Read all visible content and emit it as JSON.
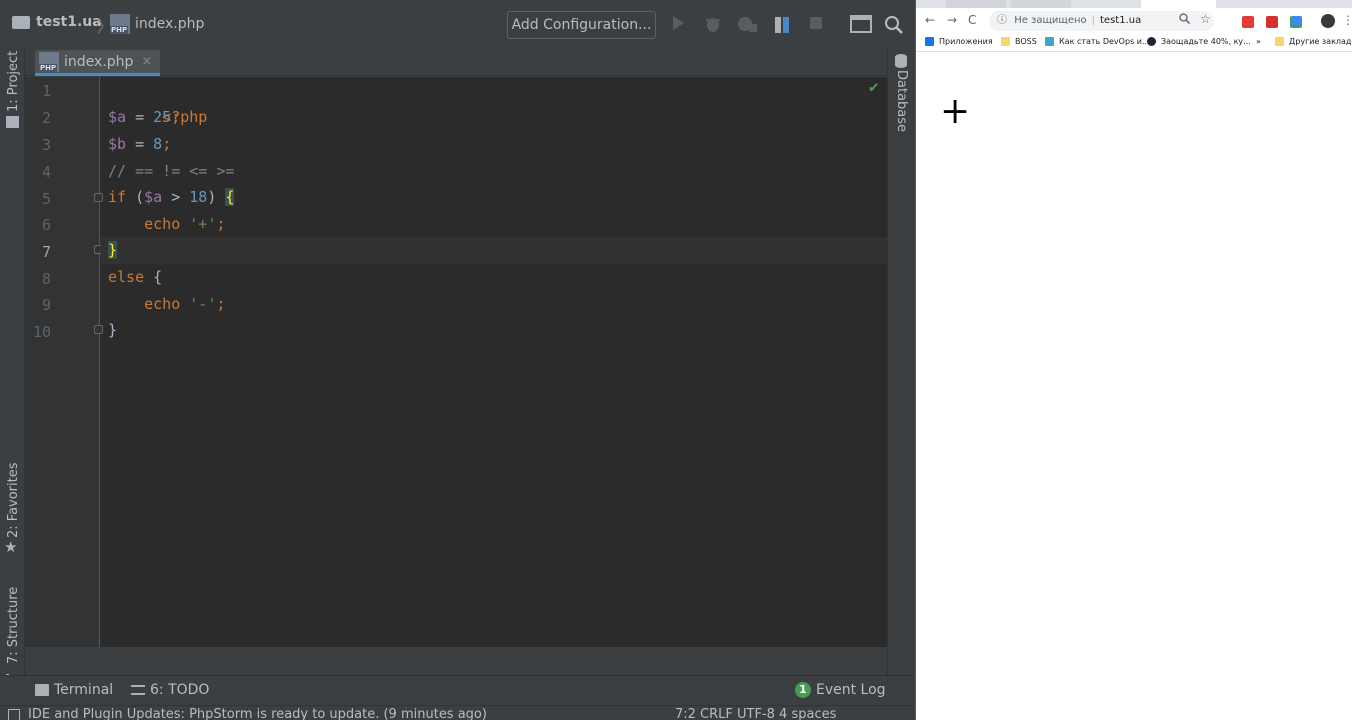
{
  "ide": {
    "breadcrumb": {
      "project": "test1.ua",
      "separator": "〉",
      "file": "index.php"
    },
    "toolbar": {
      "add_config_label": "Add Configuration...",
      "run_icon": "run-icon",
      "debug_icon": "debug-icon",
      "coverage_icon": "coverage-icon",
      "profile_icon": "profile-icon",
      "stop_icon": "stop-icon",
      "layout_icon": "layout-icon",
      "search_icon": "search-icon"
    },
    "left_strip": {
      "project": "1: Project",
      "favorites": "2: Favorites",
      "structure": "7: Structure"
    },
    "right_strip": {
      "database": "Database"
    },
    "tab": {
      "label": "index.php",
      "close": "×"
    },
    "editor": {
      "line_numbers": [
        "1",
        "2",
        "3",
        "4",
        "5",
        "6",
        "7",
        "8",
        "9",
        "10"
      ],
      "active_line": 7,
      "lines": [
        {
          "open_tag": "<?php"
        },
        {
          "var": "$a",
          "op": " = ",
          "num": "25",
          "end": ";"
        },
        {
          "var": "$b",
          "op": " = ",
          "num": "8",
          "end": ";"
        },
        {
          "comment": "// == != <= >="
        },
        {
          "kw": "if",
          "p1": " (",
          "var": "$a",
          "mid": " > ",
          "num": "18",
          "p2": ") ",
          "brace": "{"
        },
        {
          "indent": "    ",
          "kw": "echo",
          "sp": " ",
          "str": "'+'",
          "end": ";"
        },
        {
          "brace": "}"
        },
        {
          "kw": "else",
          "rest": " {"
        },
        {
          "indent": "    ",
          "kw": "echo",
          "sp": " ",
          "str": "'-'",
          "end": ";"
        },
        {
          "brace": "}"
        }
      ],
      "check_mark": "✔"
    },
    "bottom_tabs": {
      "terminal": "Terminal",
      "todo": "6: TODO",
      "event_log": "Event Log",
      "event_count": "1"
    },
    "status": {
      "message": "IDE and Plugin Updates: PhpStorm is ready to update. (9 minutes ago)",
      "right": "7:2  CRLF  UTF-8  4 spaces"
    }
  },
  "browser": {
    "nav": {
      "back": "←",
      "forward": "→",
      "reload": "C"
    },
    "omnibox": {
      "info": "ⓘ",
      "security": "Не защищено",
      "separator": "|",
      "url": "test1.ua"
    },
    "bookmarks": {
      "apps": "Приложения",
      "boss": "BOSS",
      "devops": "Как стать DevOps и...",
      "steam": "Заощадьте 40%, ку...",
      "more": "»",
      "other": "Другие закладки"
    },
    "page_output": "+"
  },
  "colors": {
    "ide_bg": "#2b2b2b",
    "keyword": "#cc7832",
    "variable": "#9876aa",
    "number": "#6897bb",
    "string": "#6a8759",
    "comment": "#808080",
    "accent": "#4a88c7"
  }
}
